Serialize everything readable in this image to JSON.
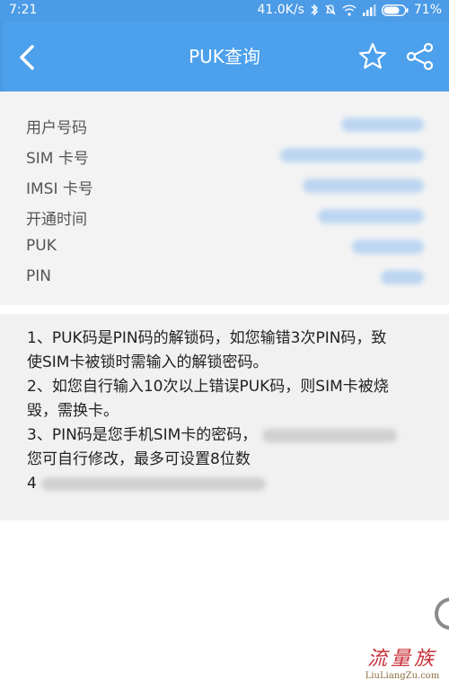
{
  "status_bar": {
    "time": "7:21",
    "speed": "41.0K/s",
    "battery": "71%"
  },
  "app_bar": {
    "title": "PUK查询"
  },
  "info": [
    {
      "label": "用户号码"
    },
    {
      "label": "SIM 卡号"
    },
    {
      "label": "IMSI 卡号"
    },
    {
      "label": "开通时间"
    },
    {
      "label": "PUK"
    },
    {
      "label": "PIN"
    }
  ],
  "notes": {
    "note1_line1": "1、PUK码是PIN码的解锁码，如您输错3次PIN码，致",
    "note1_line2": "使SIM卡被锁时需输入的解锁密码。",
    "note2_line1": "2、如您自行输入10次以上错误PUK码，则SIM卡被烧",
    "note2_line2": "毁，需换卡。",
    "note3_line1": "3、PIN码是您手机SIM卡的密码，",
    "note3_line2": "您可自行修改，最多可设置8位数",
    "note4_prefix": "4"
  },
  "watermark": {
    "cn": "流量族",
    "en": "LiuLiangZu.com"
  },
  "colors": {
    "app_bar": "#4ca0ec",
    "status_bar": "#4c9be6",
    "info_bg": "#f3f3f3",
    "notes_bg": "#f1f1f1"
  },
  "icons": [
    "back-arrow-icon",
    "star-icon",
    "share-icon",
    "bluetooth-icon",
    "mute-icon",
    "wifi-icon",
    "signal-icon",
    "battery-icon"
  ]
}
